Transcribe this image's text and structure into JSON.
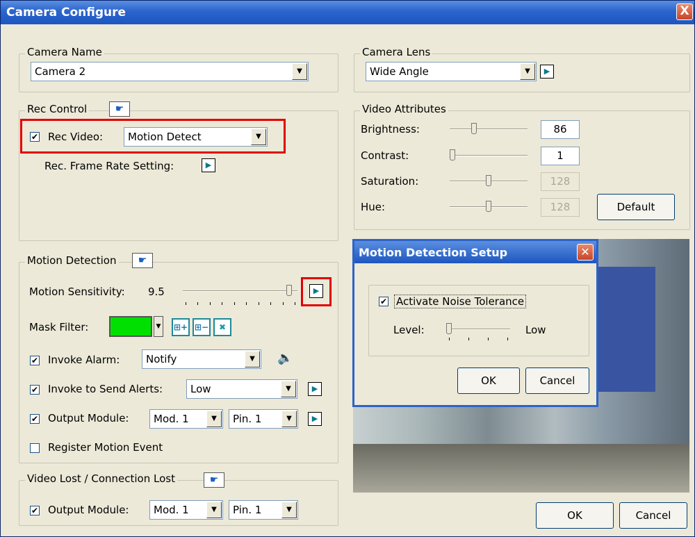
{
  "window": {
    "title": "Camera Configure",
    "close": "X"
  },
  "camera_name": {
    "legend": "Camera Name",
    "value": "Camera 2"
  },
  "camera_lens": {
    "legend": "Camera Lens",
    "value": "Wide Angle"
  },
  "rec_control": {
    "legend": "Rec Control",
    "rec_video_label": "Rec Video:",
    "rec_video_checked": true,
    "rec_video_value": "Motion Detect",
    "frame_rate_label": "Rec. Frame Rate Setting:"
  },
  "video_attributes": {
    "legend": "Video Attributes",
    "rows": [
      {
        "label": "Brightness:",
        "value": "86",
        "level": 0.3,
        "enabled": true
      },
      {
        "label": "Contrast:",
        "value": "1",
        "level": 0.0,
        "enabled": true
      },
      {
        "label": "Saturation:",
        "value": "128",
        "level": 0.5,
        "enabled": false
      },
      {
        "label": "Hue:",
        "value": "128",
        "level": 0.5,
        "enabled": false
      }
    ],
    "default_button": "Default"
  },
  "motion_detection": {
    "legend": "Motion Detection",
    "sensitivity_label": "Motion Sensitivity:",
    "sensitivity_value": "9.5",
    "sensitivity_level": 0.95,
    "mask_filter_label": "Mask Filter:",
    "mask_color": "#00e000",
    "invoke_alarm_label": "Invoke Alarm:",
    "invoke_alarm_value": "Notify",
    "send_alerts_label": "Invoke to Send Alerts:",
    "send_alerts_value": "Low",
    "output_module_label": "Output Module:",
    "module_value": "Mod. 1",
    "pin_value": "Pin. 1",
    "register_label": "Register Motion Event"
  },
  "video_lost": {
    "legend": "Video Lost / Connection Lost",
    "output_module_label": "Output Module:",
    "module_value": "Mod. 1",
    "pin_value": "Pin. 1"
  },
  "dialog": {
    "title": "Motion Detection Setup",
    "noise_label": "Activate Noise Tolerance",
    "level_label": "Level:",
    "level_text": "Low",
    "level": 0.0,
    "ok": "OK",
    "cancel": "Cancel"
  },
  "footer": {
    "ok": "OK",
    "cancel": "Cancel"
  }
}
